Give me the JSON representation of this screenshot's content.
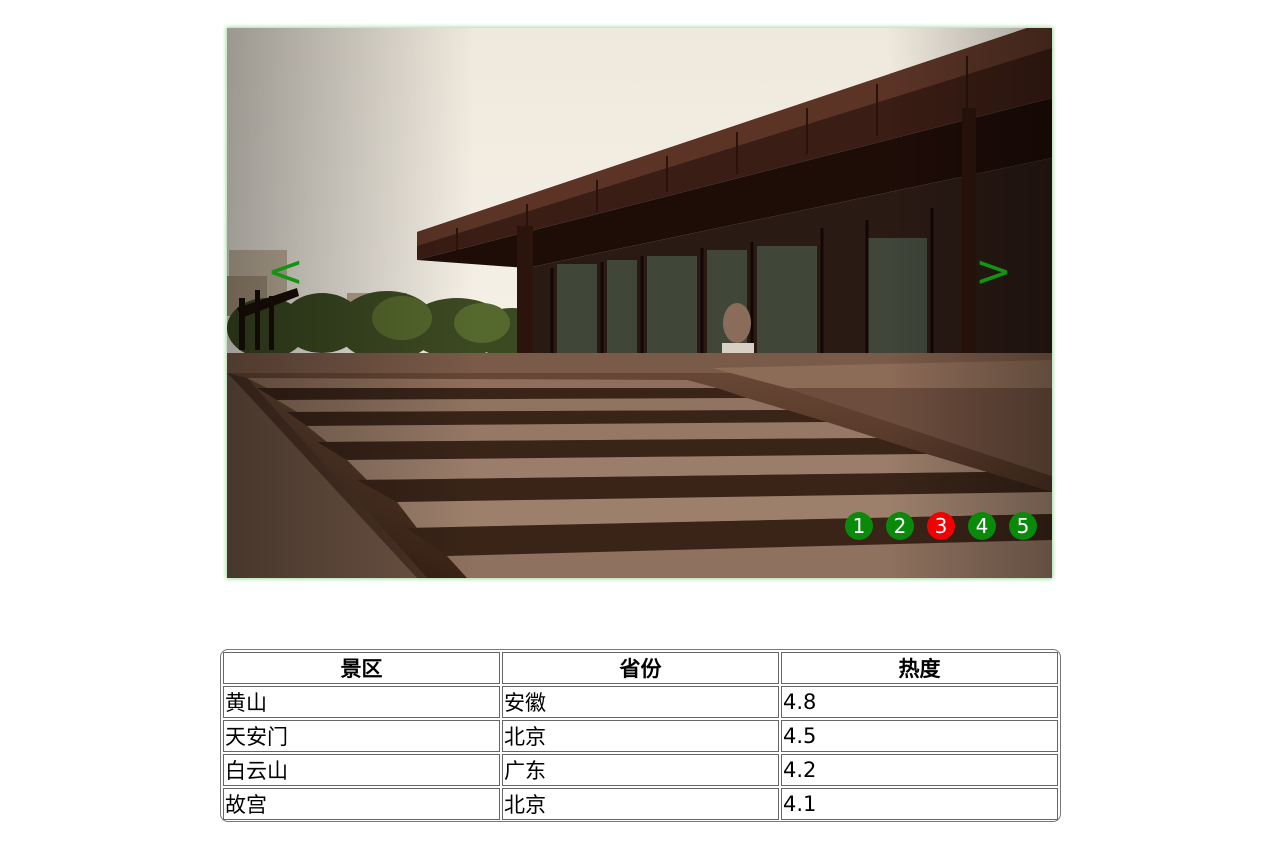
{
  "carousel": {
    "prev_label": "<",
    "next_label": ">",
    "indicators": [
      "1",
      "2",
      "3",
      "4",
      "5"
    ],
    "active_index": 3,
    "colors": {
      "indicator": "#0a8a0a",
      "indicator_active": "#f00000",
      "arrow": "#119511"
    },
    "image_subject": "modern glass building with wide stone steps"
  },
  "table": {
    "headers": [
      "景区",
      "省份",
      "热度"
    ],
    "rows": [
      [
        "黄山",
        "安徽",
        "4.8"
      ],
      [
        "天安门",
        "北京",
        "4.5"
      ],
      [
        "白云山",
        "广东",
        "4.2"
      ],
      [
        "故宫",
        "北京",
        "4.1"
      ]
    ]
  }
}
